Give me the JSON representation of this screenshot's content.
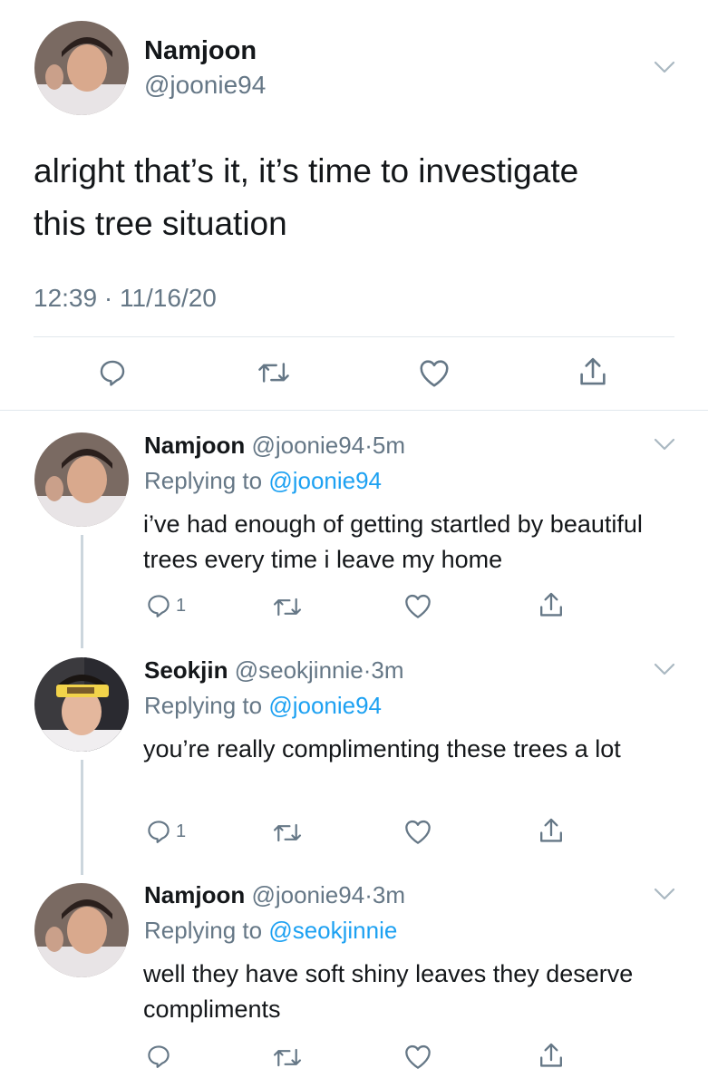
{
  "main_tweet": {
    "name": "Namjoon",
    "handle": "@joonie94",
    "text_line1": "alright that’s it, it’s time to investigate",
    "text_line2": "this tree situation",
    "timestamp": "12:39 · 11/16/20"
  },
  "replies": [
    {
      "name": "Namjoon",
      "handle": "@joonie94",
      "time": "5m",
      "replying_prefix": "Replying to",
      "replying_to": "@joonie94",
      "text": "i’ve had enough of getting startled by beautiful trees every time i leave my home",
      "reply_count": "1"
    },
    {
      "name": "Seokjin",
      "handle": "@seokjinnie",
      "time": "3m",
      "replying_prefix": "Replying to",
      "replying_to": "@joonie94",
      "text": "you’re really complimenting these trees a lot",
      "reply_count": "1"
    },
    {
      "name": "Namjoon",
      "handle": "@joonie94",
      "time": "3m",
      "replying_prefix": "Replying to",
      "replying_to": "@seokjinnie",
      "text": "well they have soft shiny leaves they deserve compliments",
      "reply_count": ""
    }
  ],
  "separator": "·",
  "icons": {
    "reply": "reply-icon",
    "retweet": "retweet-icon",
    "like": "heart-icon",
    "share": "share-icon",
    "menu": "chevron-down-icon"
  },
  "colors": {
    "text": "#14171a",
    "secondary": "#657786",
    "link": "#1da1f2",
    "divider": "#e1e8ed",
    "thread_line": "#ccd6dd"
  }
}
